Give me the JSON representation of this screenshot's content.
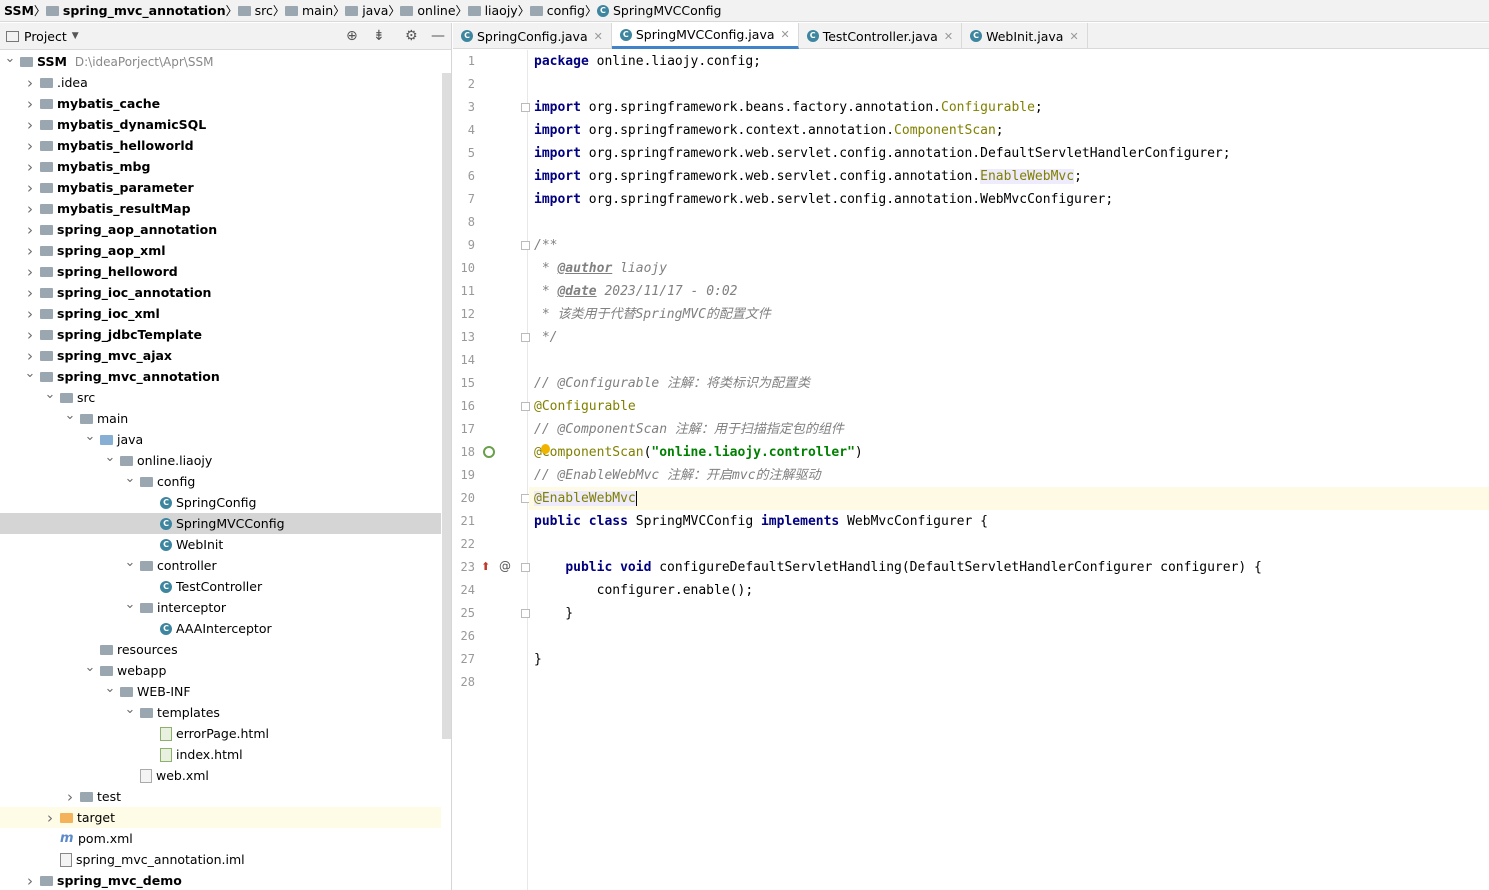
{
  "breadcrumb": [
    "SSM",
    "spring_mvc_annotation",
    "src",
    "main",
    "java",
    "online",
    "liaojy",
    "config",
    "SpringMVCConfig"
  ],
  "project_panel": {
    "title": "Project",
    "tree": [
      {
        "name": "SSM",
        "path": "D:\\ideaPorject\\Apr\\SSM",
        "depth": 0,
        "arrow": "down",
        "icon": "module",
        "bold": true
      },
      {
        "name": ".idea",
        "depth": 1,
        "arrow": "right",
        "icon": "folder"
      },
      {
        "name": "mybatis_cache",
        "depth": 1,
        "arrow": "right",
        "icon": "module",
        "bold": true
      },
      {
        "name": "mybatis_dynamicSQL",
        "depth": 1,
        "arrow": "right",
        "icon": "module",
        "bold": true
      },
      {
        "name": "mybatis_helloworld",
        "depth": 1,
        "arrow": "right",
        "icon": "module",
        "bold": true
      },
      {
        "name": "mybatis_mbg",
        "depth": 1,
        "arrow": "right",
        "icon": "module",
        "bold": true
      },
      {
        "name": "mybatis_parameter",
        "depth": 1,
        "arrow": "right",
        "icon": "module",
        "bold": true
      },
      {
        "name": "mybatis_resultMap",
        "depth": 1,
        "arrow": "right",
        "icon": "module",
        "bold": true
      },
      {
        "name": "spring_aop_annotation",
        "depth": 1,
        "arrow": "right",
        "icon": "module",
        "bold": true
      },
      {
        "name": "spring_aop_xml",
        "depth": 1,
        "arrow": "right",
        "icon": "module",
        "bold": true
      },
      {
        "name": "spring_helloword",
        "depth": 1,
        "arrow": "right",
        "icon": "module",
        "bold": true
      },
      {
        "name": "spring_ioc_annotation",
        "depth": 1,
        "arrow": "right",
        "icon": "module",
        "bold": true
      },
      {
        "name": "spring_ioc_xml",
        "depth": 1,
        "arrow": "right",
        "icon": "module",
        "bold": true
      },
      {
        "name": "spring_jdbcTemplate",
        "depth": 1,
        "arrow": "right",
        "icon": "module",
        "bold": true
      },
      {
        "name": "spring_mvc_ajax",
        "depth": 1,
        "arrow": "right",
        "icon": "module",
        "bold": true
      },
      {
        "name": "spring_mvc_annotation",
        "depth": 1,
        "arrow": "down",
        "icon": "module",
        "bold": true
      },
      {
        "name": "src",
        "depth": 2,
        "arrow": "down",
        "icon": "folder"
      },
      {
        "name": "main",
        "depth": 3,
        "arrow": "down",
        "icon": "folder"
      },
      {
        "name": "java",
        "depth": 4,
        "arrow": "down",
        "icon": "folder-blue"
      },
      {
        "name": "online.liaojy",
        "depth": 5,
        "arrow": "down",
        "icon": "folder"
      },
      {
        "name": "config",
        "depth": 6,
        "arrow": "down",
        "icon": "folder"
      },
      {
        "name": "SpringConfig",
        "depth": 7,
        "icon": "class"
      },
      {
        "name": "SpringMVCConfig",
        "depth": 7,
        "icon": "class",
        "selected": true
      },
      {
        "name": "WebInit",
        "depth": 7,
        "icon": "class"
      },
      {
        "name": "controller",
        "depth": 6,
        "arrow": "down",
        "icon": "folder"
      },
      {
        "name": "TestController",
        "depth": 7,
        "icon": "class"
      },
      {
        "name": "interceptor",
        "depth": 6,
        "arrow": "down",
        "icon": "folder"
      },
      {
        "name": "AAAInterceptor",
        "depth": 7,
        "icon": "class"
      },
      {
        "name": "resources",
        "depth": 4,
        "icon": "folder"
      },
      {
        "name": "webapp",
        "depth": 4,
        "arrow": "down",
        "icon": "folder"
      },
      {
        "name": "WEB-INF",
        "depth": 5,
        "arrow": "down",
        "icon": "folder"
      },
      {
        "name": "templates",
        "depth": 6,
        "arrow": "down",
        "icon": "folder"
      },
      {
        "name": "errorPage.html",
        "depth": 7,
        "icon": "html"
      },
      {
        "name": "index.html",
        "depth": 7,
        "icon": "html"
      },
      {
        "name": "web.xml",
        "depth": 6,
        "icon": "xml"
      },
      {
        "name": "test",
        "depth": 3,
        "arrow": "right",
        "icon": "folder"
      },
      {
        "name": "target",
        "depth": 2,
        "arrow": "right",
        "icon": "folder-orange",
        "highlight": true
      },
      {
        "name": "pom.xml",
        "depth": 2,
        "icon": "pom"
      },
      {
        "name": "spring_mvc_annotation.iml",
        "depth": 2,
        "icon": "iml"
      },
      {
        "name": "spring_mvc_demo",
        "depth": 1,
        "arrow": "right",
        "icon": "module",
        "bold": true
      }
    ]
  },
  "tabs": [
    {
      "label": "SpringConfig.java",
      "active": false
    },
    {
      "label": "SpringMVCConfig.java",
      "active": true
    },
    {
      "label": "TestController.java",
      "active": false
    },
    {
      "label": "WebInit.java",
      "active": false
    }
  ],
  "editor": {
    "current_line": 20,
    "lines": [
      [
        [
          "kw",
          "package"
        ],
        [
          "t",
          " online.liaojy.config;"
        ]
      ],
      [],
      [
        [
          "kw",
          "import"
        ],
        [
          "t",
          " org.springframework.beans.factory.annotation."
        ],
        [
          "an",
          "Configurable"
        ],
        [
          "t",
          ";"
        ]
      ],
      [
        [
          "kw",
          "import"
        ],
        [
          "t",
          " org.springframework.context.annotation."
        ],
        [
          "an",
          "ComponentScan"
        ],
        [
          "t",
          ";"
        ]
      ],
      [
        [
          "kw",
          "import"
        ],
        [
          "t",
          " org.springframework.web.servlet.config.annotation.DefaultServletHandlerConfigurer;"
        ]
      ],
      [
        [
          "kw",
          "import"
        ],
        [
          "t",
          " org.springframework.web.servlet.config.annotation."
        ],
        [
          "anh",
          "EnableWebMvc"
        ],
        [
          "t",
          ";"
        ]
      ],
      [
        [
          "kw",
          "import"
        ],
        [
          "t",
          " org.springframework.web.servlet.config.annotation.WebMvcConfigurer;"
        ]
      ],
      [],
      [
        [
          "cm",
          "/**"
        ]
      ],
      [
        [
          "cm",
          " * "
        ],
        [
          "uu",
          "@author"
        ],
        [
          "cm",
          " liaojy"
        ]
      ],
      [
        [
          "cm",
          " * "
        ],
        [
          "uu",
          "@date"
        ],
        [
          "cm",
          " 2023/11/17 - 0:02"
        ]
      ],
      [
        [
          "cm",
          " * 该类用于代替SpringMVC的配置文件"
        ]
      ],
      [
        [
          "cm",
          " */"
        ]
      ],
      [],
      [
        [
          "cm",
          "// @Configurable 注解：将类标识为配置类"
        ]
      ],
      [
        [
          "an",
          "@Configurable"
        ]
      ],
      [
        [
          "cm",
          "// @ComponentScan 注解：用于扫描指定包的组件"
        ]
      ],
      [
        [
          "an",
          "@ComponentScan"
        ],
        [
          "t",
          "("
        ],
        [
          "str",
          "\"online.liaojy.controller\""
        ],
        [
          "t",
          ")"
        ]
      ],
      [
        [
          "cm",
          "// @EnableWebMvc 注解：开启mvc的注解驱动"
        ]
      ],
      [
        [
          "anh",
          "@EnableWebMvc"
        ],
        [
          "cursor",
          ""
        ]
      ],
      [
        [
          "kw",
          "public class"
        ],
        [
          "t",
          " SpringMVCConfig "
        ],
        [
          "kw",
          "implements"
        ],
        [
          "t",
          " WebMvcConfigurer {"
        ]
      ],
      [],
      [
        [
          "t",
          "    "
        ],
        [
          "kw",
          "public void"
        ],
        [
          "t",
          " configureDefaultServletHandling(DefaultServletHandlerConfigurer configurer) {"
        ]
      ],
      [
        [
          "t",
          "        configurer.enable();"
        ]
      ],
      [
        [
          "t",
          "    }"
        ]
      ],
      [],
      [
        [
          "t",
          "}"
        ]
      ],
      []
    ]
  }
}
